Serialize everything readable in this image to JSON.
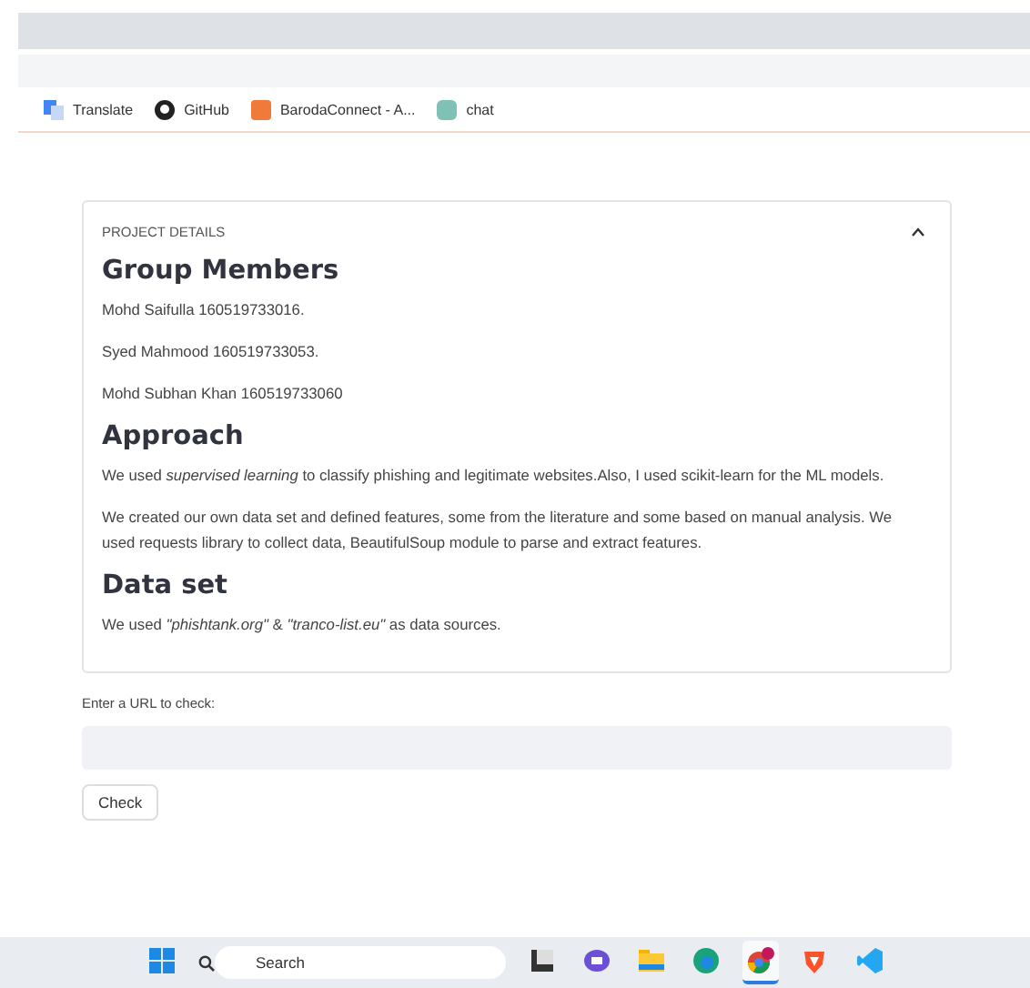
{
  "bookmarks": [
    {
      "label": "Translate",
      "kind": "translate"
    },
    {
      "label": "GitHub",
      "kind": "github"
    },
    {
      "label": "BarodaConnect - A...",
      "kind": "bank"
    },
    {
      "label": "chat",
      "kind": "chat"
    }
  ],
  "panel": {
    "title": "PROJECT DETAILS",
    "expanded": true,
    "sections": [
      {
        "heading": "Group Members",
        "paragraphs": [
          "Mohd Saifulla 160519733016.",
          "Syed Mahmood 160519733053.",
          "Mohd Subhan Khan 160519733060"
        ]
      },
      {
        "heading": "Approach",
        "paragraphs": [
          "We used *supervised learning* to classify phishing and legitimate websites.Also, I used scikit-learn for the ML models.",
          "We created our own data set and defined features, some from the literature and some based on manual analysis. We used requests library to collect data, BeautifulSoup module to parse and extract features."
        ]
      },
      {
        "heading": "Data set",
        "paragraphs": [
          "We used *\"phishtank.org\"* & *\"tranco-list.eu\"* as data sources."
        ]
      }
    ]
  },
  "url_field": {
    "label": "Enter a URL to check:"
  },
  "check_button": "Check",
  "taskbar": {
    "search": {
      "placeholder": "Search"
    },
    "apps": [
      {
        "kind": "start",
        "selected": false
      },
      {
        "kind": "taskview",
        "selected": false
      },
      {
        "kind": "meet",
        "selected": false
      },
      {
        "kind": "folder",
        "selected": false
      },
      {
        "kind": "edge",
        "selected": false
      },
      {
        "kind": "chrome",
        "selected": true
      },
      {
        "kind": "brave",
        "selected": false
      },
      {
        "kind": "vscode",
        "selected": false
      }
    ]
  }
}
